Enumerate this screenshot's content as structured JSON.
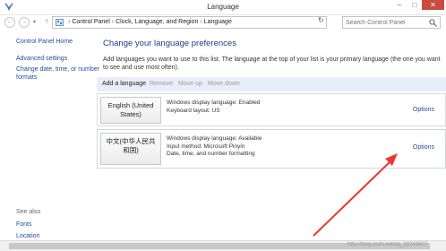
{
  "window": {
    "title": "Language",
    "minimize_glyph": "–",
    "maximize_glyph": "□",
    "close_glyph": "✕"
  },
  "addressbar": {
    "back_glyph": "←",
    "forward_glyph": "→",
    "recent_glyph": "▾",
    "up_glyph": "↑",
    "breadcrumb": [
      "Control Panel",
      "Clock, Language, and Region",
      "Language"
    ],
    "separator": "›",
    "dropdown_glyph": "▾",
    "refresh_glyph": "↻",
    "search_placeholder": "Search Control Panel"
  },
  "sidebar": {
    "home": "Control Panel Home",
    "advanced": "Advanced settings",
    "change_date": "Change date, time, or number",
    "change_date_2": "formats",
    "see_also": "See also",
    "fonts": "Fonts",
    "location": "Location"
  },
  "main": {
    "title": "Change your language preferences",
    "description": "Add languages you want to use to this list. The language at the top of your list is your primary language (the one you want to see and use most often).",
    "toolbar": {
      "add": "Add a language",
      "remove": "Remove",
      "move_up": "Move up",
      "move_down": "Move down"
    },
    "languages": [
      {
        "name_line1": "English (United",
        "name_line2": "States)",
        "info": [
          "Windows display language: Enabled",
          "Keyboard layout: US"
        ],
        "options": "Options"
      },
      {
        "name_line1": "中文(中华人民共",
        "name_line2": "和国)",
        "info": [
          "Windows display language: Available",
          "Input method: Microsoft Pinyin",
          "Date, time, and number formatting"
        ],
        "options": "Options"
      }
    ]
  },
  "watermark": "http://blog.csdn.net/qq_38249807",
  "colors": {
    "link": "#1e4d9e",
    "title": "#1e3c8c",
    "close": "#c94a3f",
    "annotation_arrow": "#e8392e"
  },
  "annotation": "red-arrow-pointing-to-chinese-options"
}
